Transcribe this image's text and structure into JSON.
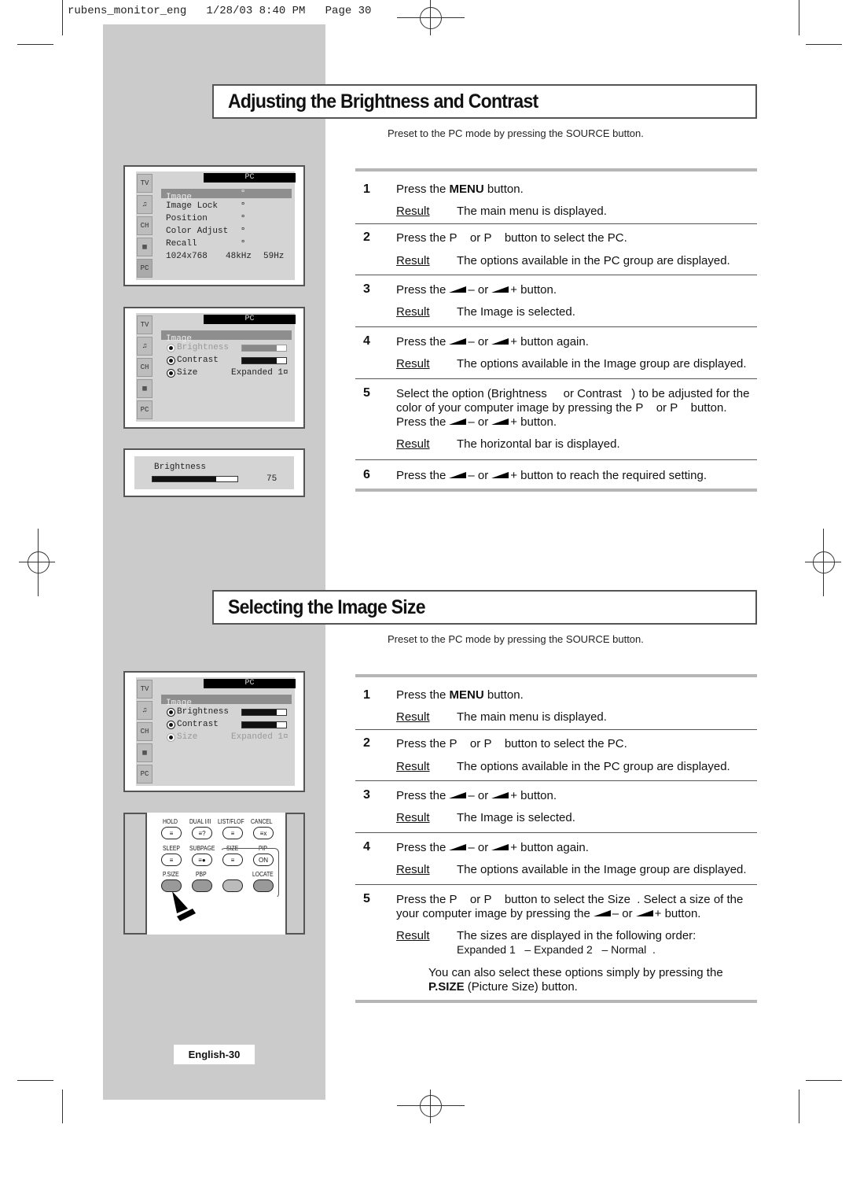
{
  "print_header": "rubens_monitor_eng   1/28/03 8:40 PM   Page 30",
  "sections": [
    {
      "title": "Adjusting the Brightness and Contrast",
      "preset_note": "Preset to the PC mode by pressing the SOURCE button.",
      "steps": [
        {
          "num": "1",
          "text_pre": "Press the ",
          "text_bold": "MENU",
          "text_post": " button.",
          "result": "The main menu is displayed."
        },
        {
          "num": "2",
          "text": "Press the P    or P    button to select the PC.",
          "result": "The options available in the PC group are displayed."
        },
        {
          "num": "3",
          "text_pre": "Press the",
          "text_mid": "– or",
          "text_post": "+ button.",
          "result": "The Image  is selected."
        },
        {
          "num": "4",
          "text_pre": "Press the",
          "text_mid": "– or",
          "text_post": "+ button again.",
          "result": "The options available in the Image  group are displayed."
        },
        {
          "num": "5",
          "line1": "Select the option (Brightness     or Contrast   ) to be adjusted for the",
          "line2": "color of your computer image by pressing the P    or P    button.",
          "text_pre": "Press the",
          "text_mid": "– or",
          "text_post": "+ button.",
          "result": "The horizontal bar is displayed."
        },
        {
          "num": "6",
          "text_pre": "Press the",
          "text_mid": "– or",
          "text_post": "+ button to reach the required setting."
        }
      ]
    },
    {
      "title": "Selecting the Image Size",
      "preset_note": "Preset to the PC mode by pressing the SOURCE button.",
      "steps": [
        {
          "num": "1",
          "text_pre": "Press the ",
          "text_bold": "MENU",
          "text_post": " button.",
          "result": "The main menu is displayed."
        },
        {
          "num": "2",
          "text": "Press the P    or P    button to select the PC.",
          "result": "The options available in the PC group are displayed."
        },
        {
          "num": "3",
          "text_pre": "Press the",
          "text_mid": "– or",
          "text_post": "+ button.",
          "result": "The Image  is selected."
        },
        {
          "num": "4",
          "text_pre": "Press the",
          "text_mid": "– or",
          "text_post": "+ button again.",
          "result": "The options available in the Image  group are displayed."
        },
        {
          "num": "5",
          "line1": "Press the P    or P    button to select the Size  . Select a size of the",
          "text_pre": "your computer image by pressing the",
          "text_mid": "– or",
          "text_post": "+ button.",
          "result": "The sizes are displayed in the following order:",
          "result2": "Expanded 1   – Expanded 2   – Normal  .",
          "note_pre": "You can also select these options simply by pressing the",
          "note_bold": "P.SIZE",
          "note_post": " (Picture Size) button."
        }
      ]
    }
  ],
  "result_label": "Result",
  "osd": {
    "header": "PC",
    "icons": [
      "picture-icon",
      "sound-icon",
      "channel-icon",
      "setup-icon",
      "pc-icon"
    ],
    "icon_labels": [
      "TV",
      "♫",
      "CH",
      "▦",
      "PC"
    ],
    "menu1": {
      "items": [
        "Image",
        "Image Lock",
        "Position",
        "Color Adjust",
        "Recall"
      ],
      "selected": "Image",
      "arrow": "¤",
      "resolution": "1024x768",
      "h_freq": "48kHz",
      "v_freq": "59Hz"
    },
    "menu2": {
      "group": "Image",
      "brightness_label": "Brightness",
      "contrast_label": "Contrast",
      "size_label": "Size",
      "size_value": "Expanded 1¤",
      "brightness_fill": 0.78,
      "contrast_fill": 0.78
    },
    "brightness_bar": {
      "label": "Brightness",
      "value": "75",
      "fill": 0.75
    }
  },
  "remote": {
    "row1": [
      "HOLD",
      "DUAL I/II",
      "LIST/FLOF",
      "CANCEL"
    ],
    "row1_glyphs": [
      "≡",
      "≡?",
      "≡",
      "≡x"
    ],
    "row2": [
      "SLEEP",
      "SUBPAGE",
      "SIZE",
      "PIP"
    ],
    "row2_glyphs": [
      "≡",
      "≡●",
      "≡",
      "ON"
    ],
    "row3": [
      "P.SIZE",
      "PBP",
      "",
      "LOCATE"
    ]
  },
  "page_tag": "English-30"
}
